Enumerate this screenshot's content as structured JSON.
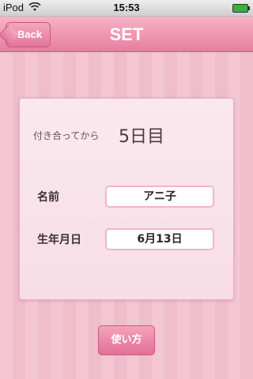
{
  "status_bar": {
    "carrier": "iPod",
    "time": "15:53"
  },
  "nav": {
    "back_label": "Back",
    "title": "SET"
  },
  "card": {
    "days_label": "付き合ってから",
    "days_value": "5日目",
    "name_label": "名前",
    "name_value": "アニ子",
    "birthday_label": "生年月日",
    "birthday_value": "6月13日"
  },
  "help_button": "使い方",
  "colors": {
    "accent": "#e77ea0",
    "background_stripe": "#f3c6d2",
    "card": "#fbe8ee"
  }
}
